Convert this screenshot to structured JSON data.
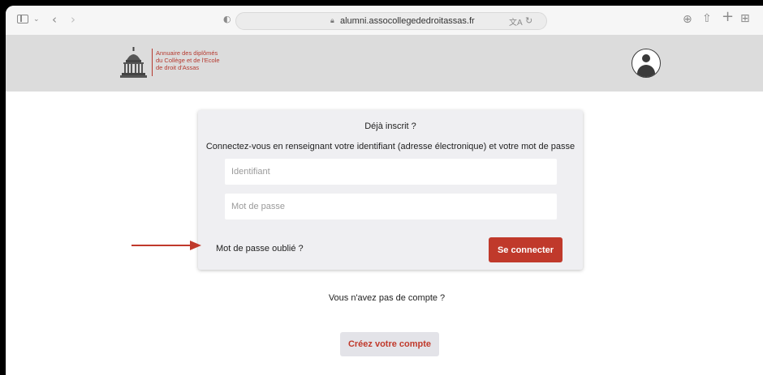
{
  "browser": {
    "url": "alumni.assocollegededroitassas.fr",
    "icons": [
      "sidebar-icon",
      "chevron-down-icon",
      "back-icon",
      "forward-icon",
      "shield-icon",
      "lock-icon",
      "translate-icon",
      "reload-icon",
      "download-icon",
      "share-icon",
      "new-tab-icon",
      "tab-overview-icon"
    ]
  },
  "header": {
    "logo_line1": "Annuaire des diplômés",
    "logo_line2": "du Collège et de l'Ecole",
    "logo_line3": "de droit d'Assas",
    "brand_color": "#b5392f"
  },
  "login": {
    "title": "Déjà inscrit ?",
    "subtitle": "Connectez-vous en renseignant votre identifiant (adresse électronique) et votre mot de passe",
    "username_placeholder": "Identifiant",
    "password_placeholder": "Mot de passe",
    "forgot_label": "Mot de passe oublié ?",
    "submit_label": "Se connecter",
    "accent": "#c0392b"
  },
  "signup": {
    "prompt": "Vous n'avez pas de compte ?",
    "button_label": "Créez votre compte"
  }
}
